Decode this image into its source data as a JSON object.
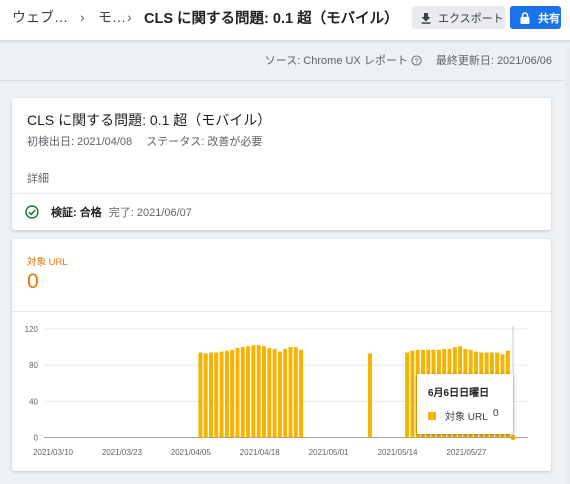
{
  "breadcrumb": {
    "item1": "ウェブ…",
    "item2": "モ…",
    "title": "CLS に関する問題: 0.1 超（モバイル）",
    "separator": "›"
  },
  "toolbar": {
    "export_label": "エクスポート",
    "share_label": "共有"
  },
  "source_bar": {
    "source_text": "ソース: Chrome UX レポート",
    "updated_text": "最終更新日: 2021/06/06"
  },
  "issue_card": {
    "title": "CLS に関する問題: 0.1 超（モバイル）",
    "first_detected": "初検出日: 2021/04/08",
    "status": "ステータス: 改善が必要",
    "details_label": "詳細",
    "validation_label": "検証: 合格",
    "validation_status": "完了: 2021/06/07"
  },
  "chart_card": {
    "count_label": "対象 URL",
    "count_value": "0",
    "tooltip": {
      "date": "6月6日日曜日",
      "series_label": "対象 URL",
      "value": "0"
    }
  },
  "colors": {
    "accent_orange": "#e37400",
    "bar_yellow": "#f4b400",
    "share_blue": "#1a73e8",
    "success_green": "#188038"
  },
  "chart_data": {
    "type": "bar",
    "ylim": [
      0,
      120
    ],
    "yticks": [
      "0",
      "40",
      "80",
      "120"
    ],
    "xticks": [
      "2021/03/10",
      "2021/03/23",
      "2021/04/05",
      "2021/04/18",
      "2021/05/01",
      "2021/05/14",
      "2021/05/27"
    ],
    "xtick_offsets": [
      0,
      13,
      26,
      39,
      52,
      65,
      78
    ],
    "start_date": "2021/03/10",
    "series": [
      {
        "values": [
          0,
          0,
          0,
          0,
          0,
          0,
          0,
          0,
          0,
          0,
          0,
          0,
          0,
          0,
          0,
          0,
          0,
          0,
          0,
          0,
          0,
          0,
          0,
          0,
          0,
          0,
          0,
          0,
          0,
          94,
          93,
          94,
          94,
          95,
          96,
          97,
          99,
          100,
          101,
          102,
          102,
          101,
          99,
          98,
          95,
          98,
          100,
          100,
          97,
          0,
          0,
          0,
          0,
          0,
          0,
          0,
          0,
          0,
          0,
          0,
          0,
          93,
          0,
          0,
          0,
          0,
          0,
          0,
          94,
          96,
          97,
          97,
          97,
          97,
          97,
          98,
          98,
          100,
          101,
          98,
          97,
          95,
          94,
          94,
          94,
          94,
          92,
          96,
          0
        ]
      }
    ]
  }
}
